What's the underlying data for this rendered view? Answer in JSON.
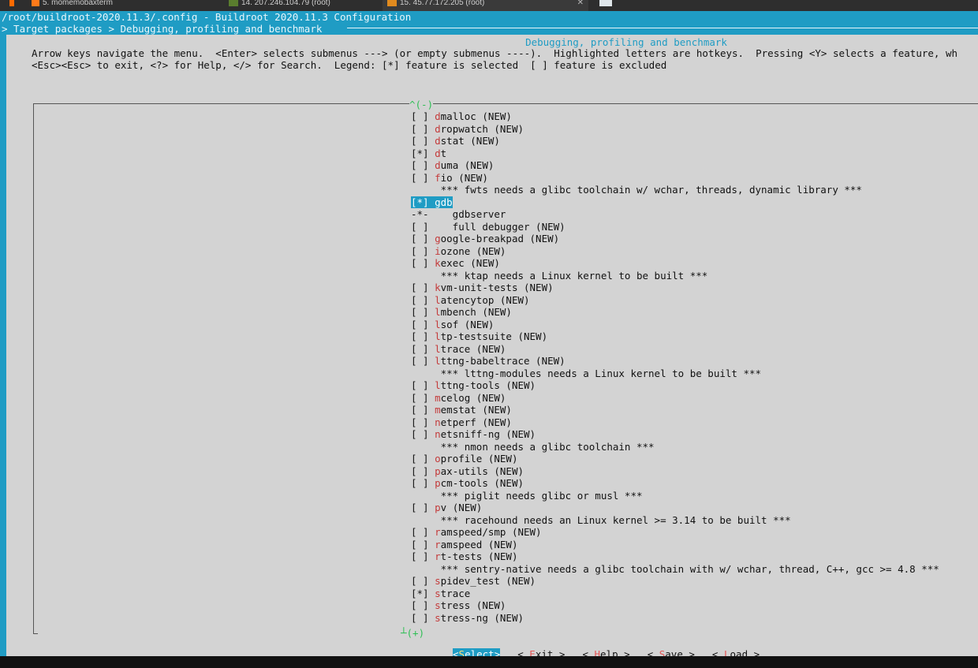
{
  "tabs": [
    {
      "label": "5. momemobaxterm"
    },
    {
      "label": "14. 207.246.104.79 (root)"
    },
    {
      "label": "15. 45.77.172.205 (root)"
    }
  ],
  "terminal": {
    "title": "/root/buildroot-2020.11.3/.config - Buildroot 2020.11.3 Configuration",
    "breadcrumb": "> Target packages > Debugging, profiling and benchmark"
  },
  "dialog": {
    "heading": "Debugging, profiling and benchmark",
    "help_line_1": "Arrow keys navigate the menu.  <Enter> selects submenus ---> (or empty submenus ----).  Highlighted letters are hotkeys.  Pressing <Y> selects a feature, wh",
    "help_line_2": "<Esc><Esc> to exit, <?> for Help, </> for Search.  Legend: [*] feature is selected  [ ] feature is excluded",
    "scroll_up": "^(-)",
    "scroll_down": "┴(+)"
  },
  "menu": [
    {
      "mark": "[ ]",
      "hk": "d",
      "rest": "malloc (NEW)"
    },
    {
      "mark": "[ ]",
      "hk": "d",
      "rest": "ropwatch (NEW)"
    },
    {
      "mark": "[ ]",
      "hk": "d",
      "rest": "stat (NEW)"
    },
    {
      "mark": "[*]",
      "hk": "d",
      "rest": "t"
    },
    {
      "mark": "[ ]",
      "hk": "d",
      "rest": "uma (NEW)"
    },
    {
      "mark": "[ ]",
      "hk": "f",
      "rest": "io (NEW)"
    },
    {
      "mark": "   ",
      "hk": "",
      "rest": " *** fwts needs a glibc toolchain w/ wchar, threads, dynamic library ***"
    },
    {
      "mark": "[*]",
      "hk": "g",
      "rest": "db",
      "selected": true
    },
    {
      "mark": "-*-",
      "hk": "",
      "rest": "   gdbserver",
      "hk_inner": "g"
    },
    {
      "mark": "[ ]",
      "hk": "",
      "rest": "   full debugger (NEW)"
    },
    {
      "mark": "[ ]",
      "hk": "g",
      "rest": "oogle-breakpad (NEW)"
    },
    {
      "mark": "[ ]",
      "hk": "i",
      "rest": "ozone (NEW)"
    },
    {
      "mark": "[ ]",
      "hk": "k",
      "rest": "exec (NEW)"
    },
    {
      "mark": "   ",
      "hk": "",
      "rest": " *** ktap needs a Linux kernel to be built ***"
    },
    {
      "mark": "[ ]",
      "hk": "k",
      "rest": "vm-unit-tests (NEW)"
    },
    {
      "mark": "[ ]",
      "hk": "l",
      "rest": "atencytop (NEW)"
    },
    {
      "mark": "[ ]",
      "hk": "l",
      "rest": "mbench (NEW)"
    },
    {
      "mark": "[ ]",
      "hk": "l",
      "rest": "sof (NEW)"
    },
    {
      "mark": "[ ]",
      "hk": "l",
      "rest": "tp-testsuite (NEW)"
    },
    {
      "mark": "[ ]",
      "hk": "l",
      "rest": "trace (NEW)"
    },
    {
      "mark": "[ ]",
      "hk": "l",
      "rest": "ttng-babeltrace (NEW)"
    },
    {
      "mark": "   ",
      "hk": "",
      "rest": " *** lttng-modules needs a Linux kernel to be built ***"
    },
    {
      "mark": "[ ]",
      "hk": "l",
      "rest": "ttng-tools (NEW)"
    },
    {
      "mark": "[ ]",
      "hk": "m",
      "rest": "celog (NEW)"
    },
    {
      "mark": "[ ]",
      "hk": "m",
      "rest": "emstat (NEW)"
    },
    {
      "mark": "[ ]",
      "hk": "n",
      "rest": "etperf (NEW)"
    },
    {
      "mark": "[ ]",
      "hk": "n",
      "rest": "etsniff-ng (NEW)"
    },
    {
      "mark": "   ",
      "hk": "",
      "rest": " *** nmon needs a glibc toolchain ***"
    },
    {
      "mark": "[ ]",
      "hk": "o",
      "rest": "profile (NEW)"
    },
    {
      "mark": "[ ]",
      "hk": "p",
      "rest": "ax-utils (NEW)"
    },
    {
      "mark": "[ ]",
      "hk": "p",
      "rest": "cm-tools (NEW)"
    },
    {
      "mark": "   ",
      "hk": "",
      "rest": " *** piglit needs glibc or musl ***"
    },
    {
      "mark": "[ ]",
      "hk": "p",
      "rest": "v (NEW)"
    },
    {
      "mark": "   ",
      "hk": "",
      "rest": " *** racehound needs an Linux kernel >= 3.14 to be built ***"
    },
    {
      "mark": "[ ]",
      "hk": "r",
      "rest": "amspeed/smp (NEW)"
    },
    {
      "mark": "[ ]",
      "hk": "r",
      "rest": "amspeed (NEW)"
    },
    {
      "mark": "[ ]",
      "hk": "r",
      "rest": "t-tests (NEW)"
    },
    {
      "mark": "   ",
      "hk": "",
      "rest": " *** sentry-native needs a glibc toolchain with w/ wchar, thread, C++, gcc >= 4.8 ***"
    },
    {
      "mark": "[ ]",
      "hk": "s",
      "rest": "pidev_test (NEW)"
    },
    {
      "mark": "[*]",
      "hk": "s",
      "rest": "trace"
    },
    {
      "mark": "[ ]",
      "hk": "s",
      "rest": "tress (NEW)"
    },
    {
      "mark": "[ ]",
      "hk": "s",
      "rest": "tress-ng (NEW)"
    }
  ],
  "buttons": [
    {
      "pre": "<",
      "hk": "S",
      "post": "elect>",
      "active": true
    },
    {
      "pre": "< ",
      "hk": "E",
      "post": "xit >"
    },
    {
      "pre": "< ",
      "hk": "H",
      "post": "elp >"
    },
    {
      "pre": "< ",
      "hk": "S",
      "post": "ave >"
    },
    {
      "pre": "< ",
      "hk": "L",
      "post": "oad >"
    }
  ]
}
